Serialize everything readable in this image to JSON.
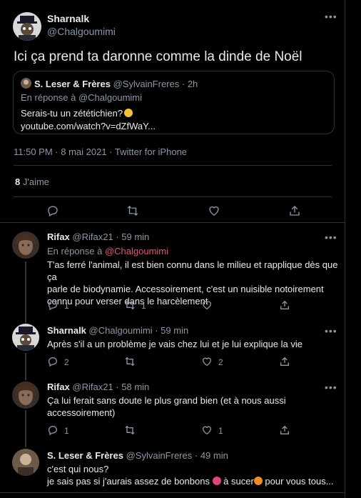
{
  "main": {
    "name": "Sharnalk",
    "handle": "@Chalgoumimi",
    "text": "Ici ça prend ta daronne comme la dinde de Noël",
    "quote": {
      "name": "S. Leser & Frères",
      "handle": "@SylvainFreres",
      "time": "· 2h",
      "reply_prefix": "En réponse à ",
      "reply_to": "@Chalgoumimi",
      "line1": "Serais-tu un zététichien?",
      "line2": "youtube.com/watch?v=dZfWaY..."
    },
    "meta": "11:50 PM · 8 mai 2021 · Twitter for iPhone",
    "likes_count": "8",
    "likes_label": "J'aime"
  },
  "replies": [
    {
      "name": "Rifax",
      "handle": "@Rifax21",
      "time": "· 59 min",
      "reply_prefix": "En réponse à ",
      "reply_to": "@Chalgoumimi",
      "line1": "T'as ferré l'animal, il est bien connu dans le milieu et rapplique dès que ça",
      "line2": "parle de biodynamie. Accessoirement, c'est un nuisible notoirement",
      "line3": "connu pour verser dans le harcèlement",
      "replies": "1",
      "retweets": "1",
      "likes": ""
    },
    {
      "name": "Sharnalk",
      "handle": "@Chalgoumimi",
      "time": "· 59 min",
      "line1": "Après s'il a un problème je vais chez lui et je lui explique la vie",
      "replies": "2",
      "retweets": "",
      "likes": "2"
    },
    {
      "name": "Rifax",
      "handle": "@Rifax21",
      "time": "· 58 min",
      "line1": "Ça lui ferait sans doute le plus grand bien (et à nous aussi",
      "line2": "accessoirement)",
      "replies": "1",
      "retweets": "",
      "likes": "1"
    },
    {
      "name": "S. Leser & Frères",
      "handle": "@SylvainFreres",
      "time": "· 49 min",
      "line1": "c'est qui nous?",
      "line2a": "je sais pas si j'aurais assez de bonbons ",
      "line2b": " à sucer",
      "line2c": " pour vous tous..."
    }
  ],
  "icons": {
    "reply": "reply-icon",
    "retweet": "retweet-icon",
    "like": "heart-icon",
    "share": "share-icon",
    "more": "more-icon"
  },
  "colors": {
    "background": "#000000",
    "mention": "#f04e6c",
    "muted": "#8b98a5"
  }
}
